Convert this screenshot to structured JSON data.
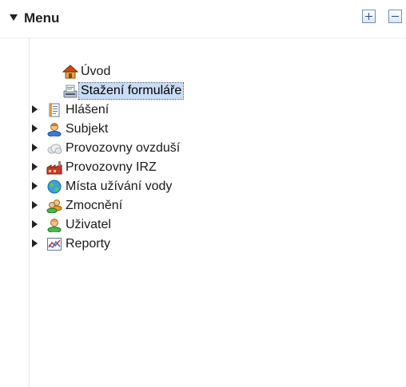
{
  "menu": {
    "title": "Menu"
  },
  "tree": {
    "items": [
      {
        "label": "Úvod",
        "icon": "home-icon"
      },
      {
        "label": "Stažení formuláře",
        "icon": "download-form-icon",
        "selected": true
      },
      {
        "label": "Hlášení",
        "icon": "report-document-icon"
      },
      {
        "label": "Subjekt",
        "icon": "subject-user-icon"
      },
      {
        "label": "Provozovny ovzduší",
        "icon": "cloud-icon"
      },
      {
        "label": "Provozovny IRZ",
        "icon": "factory-icon"
      },
      {
        "label": "Místa užívání vody",
        "icon": "globe-icon"
      },
      {
        "label": "Zmocnění",
        "icon": "users-icon"
      },
      {
        "label": "Uživatel",
        "icon": "user-icon"
      },
      {
        "label": "Reporty",
        "icon": "chart-icon"
      }
    ]
  },
  "colors": {
    "selection_bg": "#c8dcf3",
    "button_border": "#6b8fbf"
  }
}
